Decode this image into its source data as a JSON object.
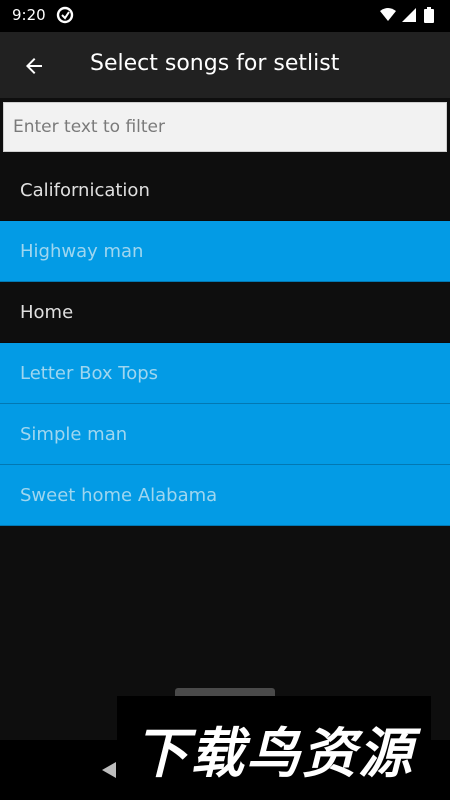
{
  "status_bar": {
    "time": "9:20",
    "icons": [
      "app-notification-icon",
      "wifi-icon",
      "signal-icon",
      "battery-icon"
    ]
  },
  "app_bar": {
    "back_icon": "arrow-left-icon",
    "title": "Select songs for setlist"
  },
  "filter": {
    "placeholder": "Enter text to filter",
    "value": ""
  },
  "songs": [
    {
      "title": "Californication",
      "selected": false
    },
    {
      "title": "Highway man",
      "selected": true
    },
    {
      "title": "Home",
      "selected": false
    },
    {
      "title": "Letter Box Tops",
      "selected": true
    },
    {
      "title": "Simple man",
      "selected": true
    },
    {
      "title": "Sweet home Alabama",
      "selected": true
    }
  ],
  "watermark": "下载鸟资源",
  "colors": {
    "selected": "#039be5",
    "app_bar": "#212121",
    "background": "#0e0e0e"
  }
}
